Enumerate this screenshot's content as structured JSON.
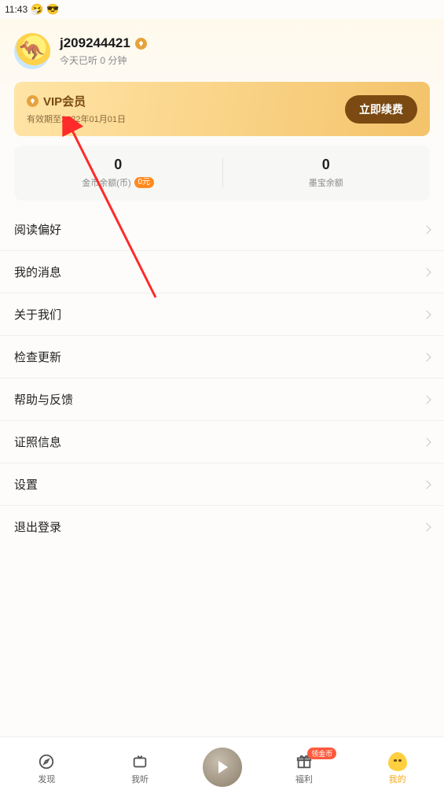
{
  "status": {
    "time": "11:43"
  },
  "profile": {
    "username": "j209244421",
    "listen_today": "今天已听 0 分钟"
  },
  "vip": {
    "title": "VIP会员",
    "subtitle": "有效期至2122年01月01日",
    "button": "立即续费"
  },
  "balance": {
    "coin": {
      "value": "0",
      "label": "金币余额(币)",
      "pill": "0元"
    },
    "mobao": {
      "value": "0",
      "label": "墨宝余额"
    }
  },
  "menu": [
    {
      "label": "阅读偏好"
    },
    {
      "label": "我的消息"
    },
    {
      "label": "关于我们"
    },
    {
      "label": "检查更新"
    },
    {
      "label": "帮助与反馈"
    },
    {
      "label": "证照信息"
    },
    {
      "label": "设置"
    },
    {
      "label": "退出登录"
    }
  ],
  "tabs": {
    "discover": "发现",
    "listen": "我听",
    "welfare": "福利",
    "welfare_badge": "领金币",
    "mine": "我的"
  }
}
